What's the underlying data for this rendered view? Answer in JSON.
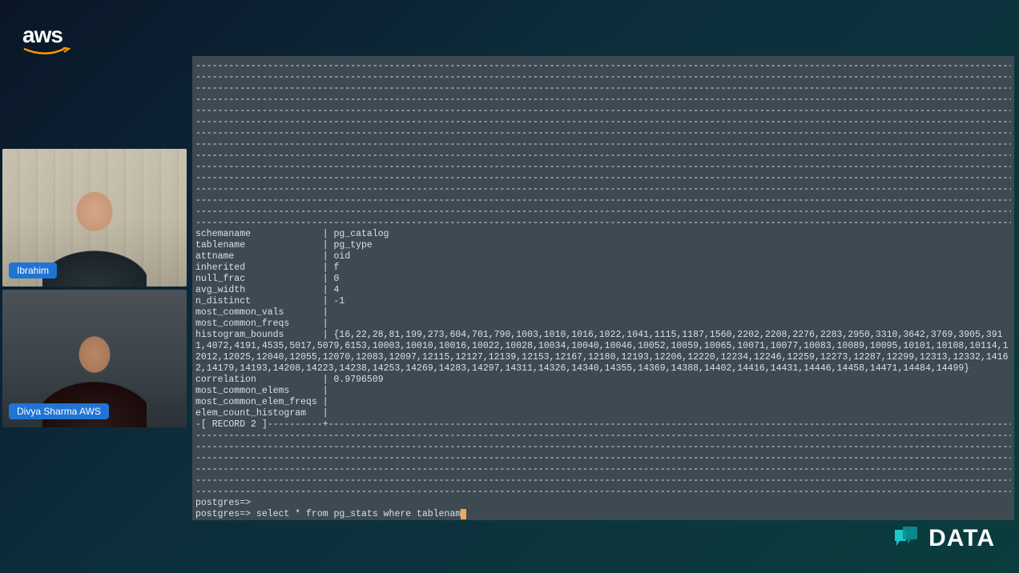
{
  "logo": {
    "aws_text": "aws",
    "data_text": "DATA"
  },
  "presenters": [
    {
      "name": "Ibrahim"
    },
    {
      "name": "Divya Sharma AWS"
    }
  ],
  "terminal": {
    "dash_block_lines": 15,
    "record1": {
      "schemaname": "pg_catalog",
      "tablename": "pg_type",
      "attname": "oid",
      "inherited": "f",
      "null_frac": "0",
      "avg_width": "4",
      "n_distinct": "-1",
      "most_common_vals": "",
      "most_common_freqs": "",
      "histogram_bounds": "{16,22,28,81,199,273,604,701,790,1003,1010,1016,1022,1041,1115,1187,1560,2202,2208,2276,2283,2950,3310,3642,3769,3905,3911,4072,4191,4535,5017,5079,6153,10003,10010,10016,10022,10028,10034,10040,10046,10052,10059,10065,10071,10077,10083,10089,10095,10101,10108,10114,12012,12025,12040,12055,12070,12083,12097,12115,12127,12139,12153,12167,12180,12193,12206,12220,12234,12246,12259,12273,12287,12299,12313,12332,14162,14179,14193,14208,14223,14238,14253,14269,14283,14297,14311,14326,14340,14355,14369,14388,14402,14416,14431,14446,14458,14471,14484,14499}",
      "correlation": "0.9796509",
      "most_common_elems": "",
      "most_common_elem_freqs": "",
      "elem_count_histogram": ""
    },
    "record2_marker": "-[ RECORD 2 ]----------+",
    "dash_block2_lines": 6,
    "prompt_empty": "postgres=>",
    "prompt_cmd_prefix": "postgres=> ",
    "prompt_cmd": "select * from pg_stats where tablenam"
  }
}
